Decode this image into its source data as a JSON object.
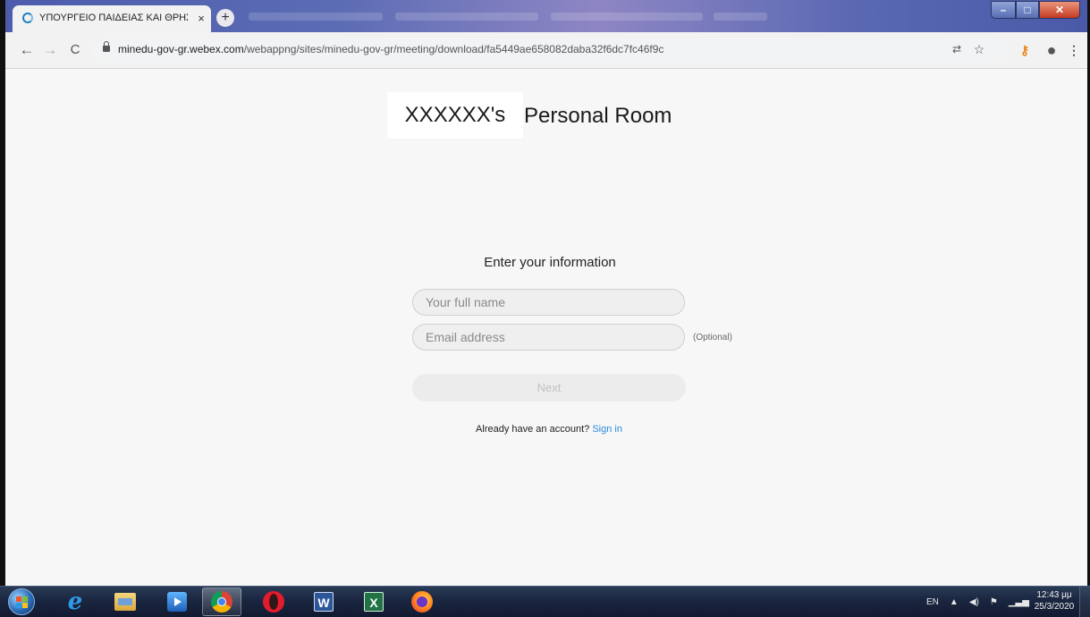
{
  "browser": {
    "tab_title": "ΥΠΟΥΡΓΕΙΟ ΠΑΙΔΕΙΑΣ ΚΑΙ ΘΡΗΣΚ",
    "tab_close": "×",
    "new_tab": "+",
    "url_domain": "minedu-gov-gr.webex.com",
    "url_path": "/webappng/sites/minedu-gov-gr/meeting/download/fa5449ae658082daba32f6dc7fc46f9c",
    "back": "←",
    "forward": "→",
    "reload": "C"
  },
  "page": {
    "owner": "XXXXXX's",
    "room_title": "Personal Room",
    "form_heading": "Enter your information",
    "name_placeholder": "Your full name",
    "email_placeholder": "Email address",
    "optional_label": "(Optional)",
    "next_label": "Next",
    "signin_prompt": "Already have an account?",
    "signin_link": "Sign in"
  },
  "taskbar": {
    "language": "EN",
    "tray_arrow": "▲",
    "clock_time": "12:43 μμ",
    "clock_date": "25/3/2020"
  },
  "colors": {
    "accent_link": "#2a8ad8",
    "page_background": "#f7f7f7",
    "tabstrip": "#5b6bb4"
  }
}
